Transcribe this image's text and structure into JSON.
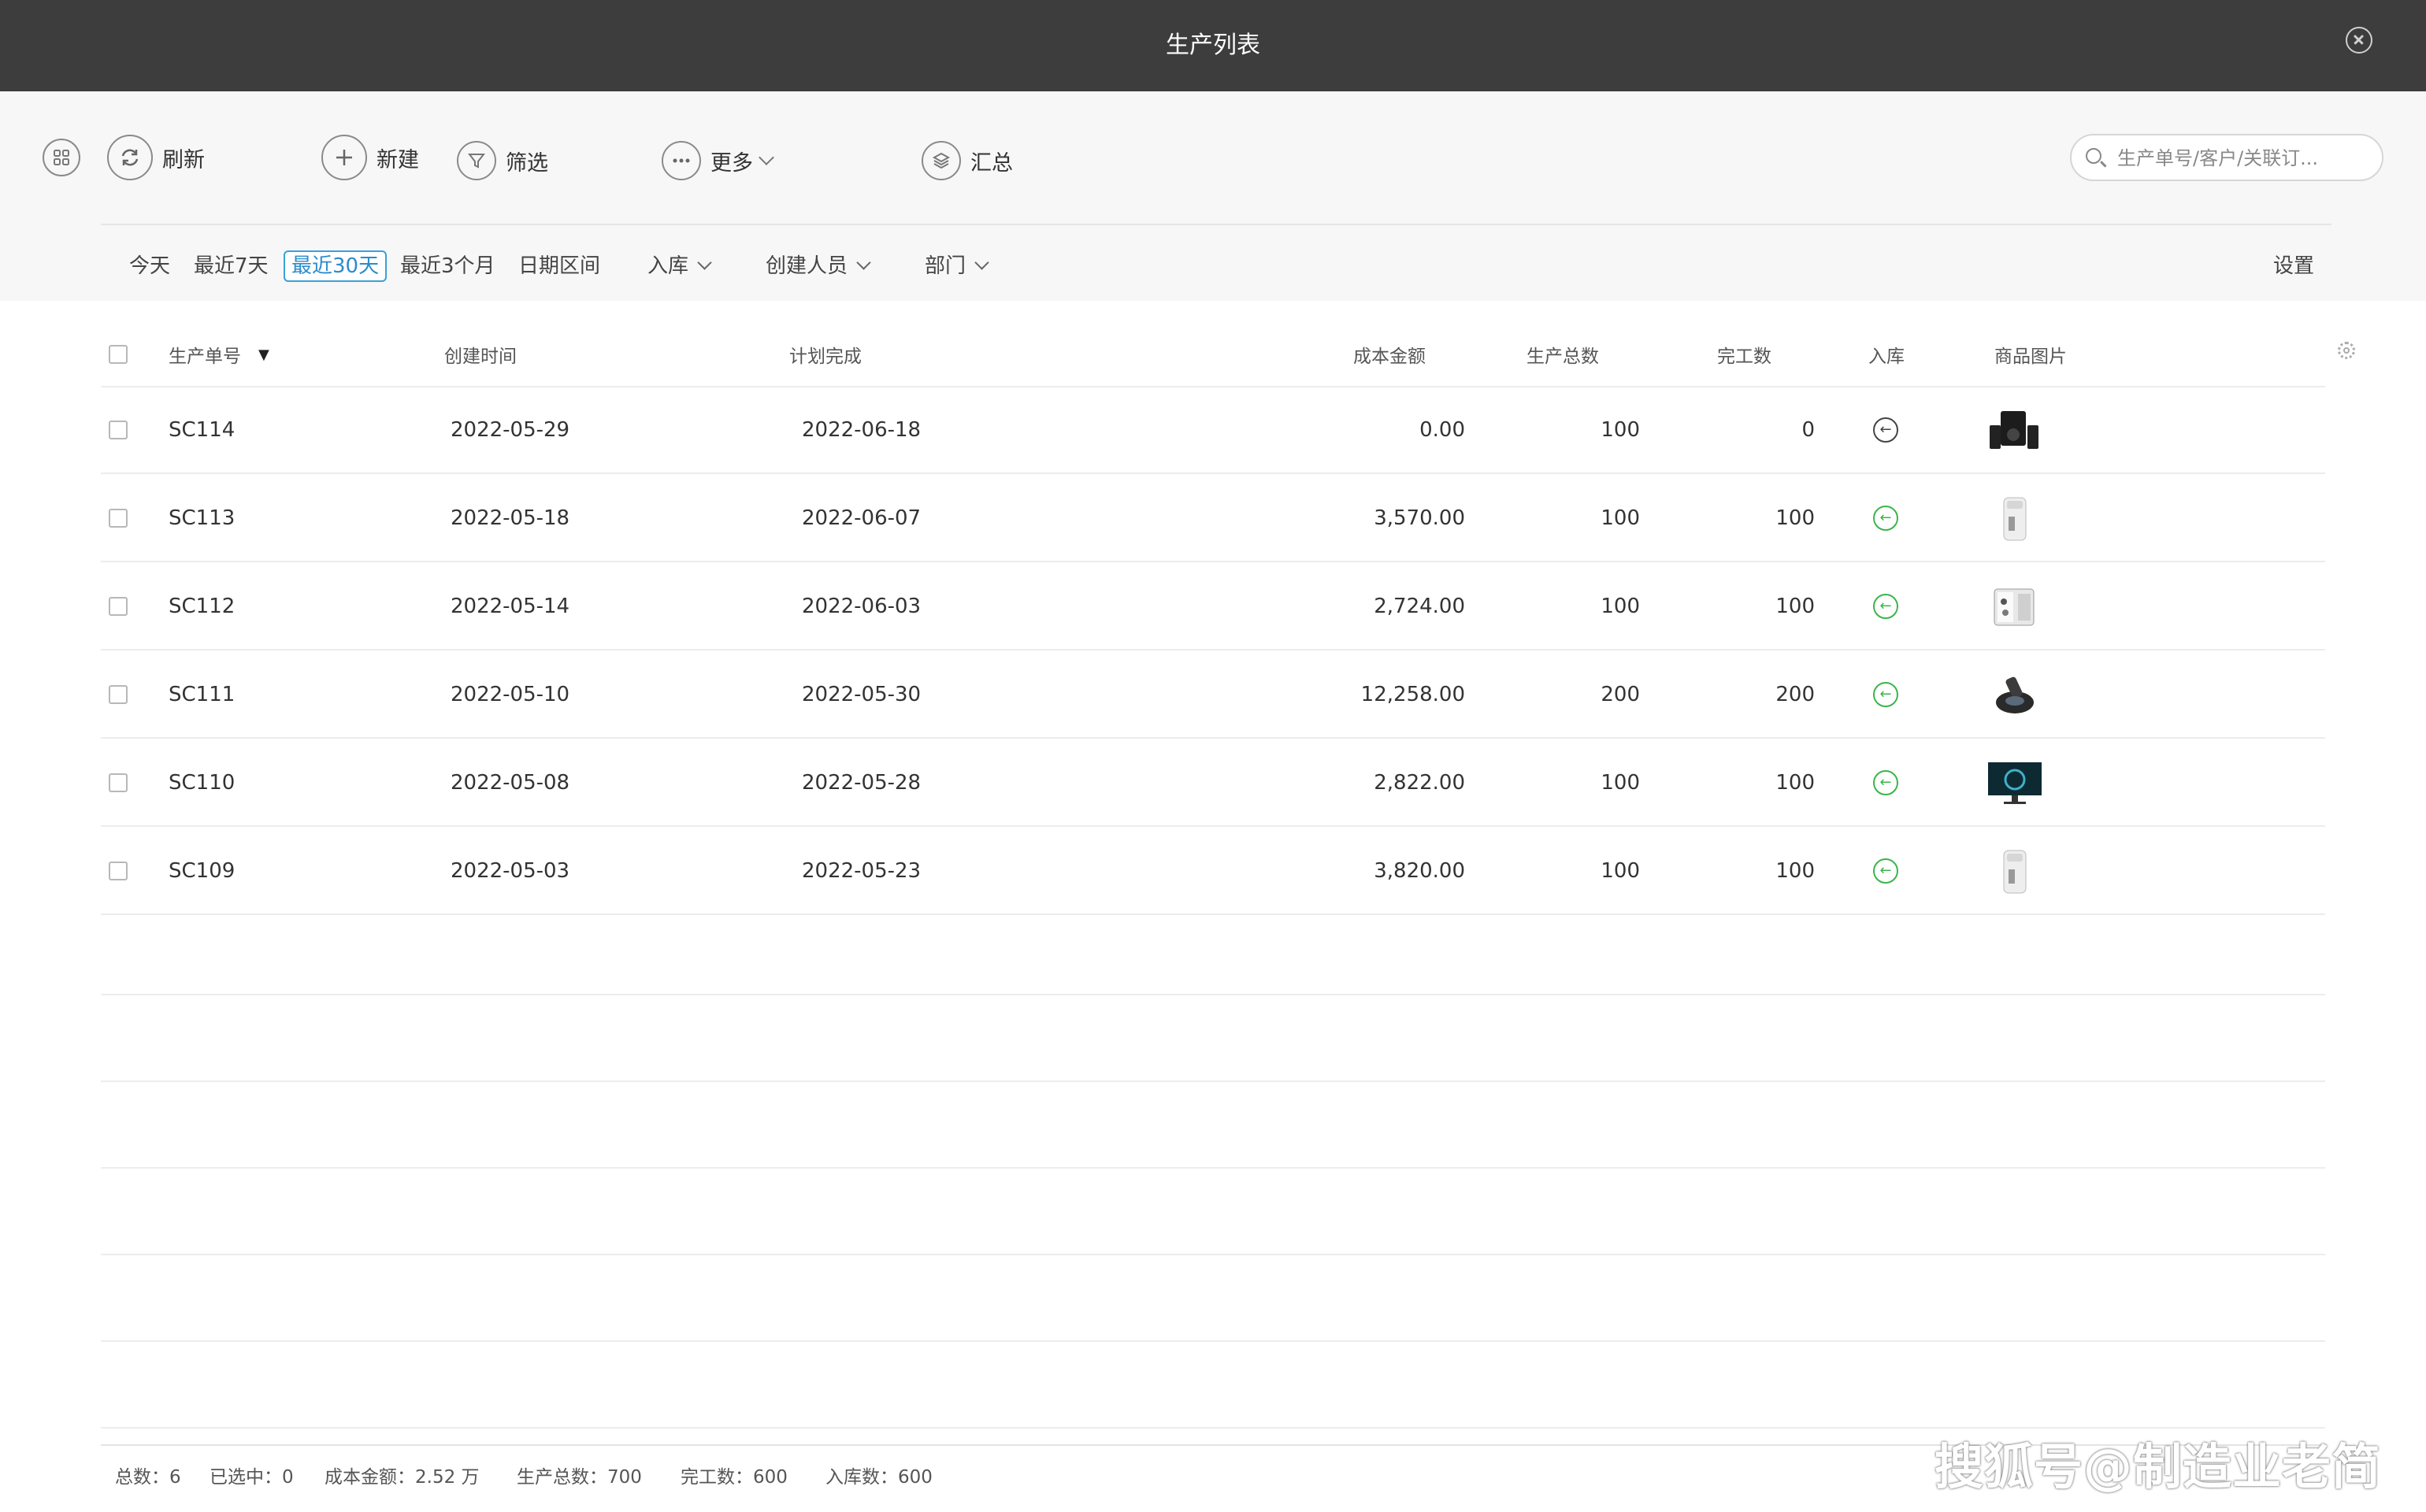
{
  "window": {
    "title": "生产列表"
  },
  "toolbar": {
    "refresh": "刷新",
    "new": "新建",
    "filter": "筛选",
    "more": "更多",
    "summary": "汇总",
    "search_placeholder": "生产单号/客户/关联订..."
  },
  "filters": {
    "today": "今天",
    "last7": "最近7天",
    "last30": "最近30天",
    "last3m": "最近3个月",
    "range": "日期区间",
    "stock": "入库",
    "creator": "创建人员",
    "dept": "部门",
    "settings": "设置",
    "active": "最近30天"
  },
  "columns": {
    "order_no": "生产单号",
    "created": "创建时间",
    "planned": "计划完成",
    "cost": "成本金额",
    "total": "生产总数",
    "done": "完工数",
    "stock": "入库",
    "image": "商品图片"
  },
  "rows": [
    {
      "order_no": "SC114",
      "created": "2022-05-29",
      "planned": "2022-06-18",
      "cost": "0.00",
      "total": "100",
      "done": "0",
      "stock_done": false,
      "image": "speakers"
    },
    {
      "order_no": "SC113",
      "created": "2022-05-18",
      "planned": "2022-06-07",
      "cost": "3,570.00",
      "total": "100",
      "done": "100",
      "stock_done": true,
      "image": "water-purifier"
    },
    {
      "order_no": "SC112",
      "created": "2022-05-14",
      "planned": "2022-06-03",
      "cost": "2,724.00",
      "total": "100",
      "done": "100",
      "stock_done": true,
      "image": "mini-fridge"
    },
    {
      "order_no": "SC111",
      "created": "2022-05-10",
      "planned": "2022-05-30",
      "cost": "12,258.00",
      "total": "200",
      "done": "200",
      "stock_done": true,
      "image": "vacuum"
    },
    {
      "order_no": "SC110",
      "created": "2022-05-08",
      "planned": "2022-05-28",
      "cost": "2,822.00",
      "total": "100",
      "done": "100",
      "stock_done": true,
      "image": "monitor"
    },
    {
      "order_no": "SC109",
      "created": "2022-05-03",
      "planned": "2022-05-23",
      "cost": "3,820.00",
      "total": "100",
      "done": "100",
      "stock_done": true,
      "image": "water-purifier"
    }
  ],
  "footer": {
    "total": "总数：6",
    "selected": "已选中：0",
    "cost": "成本金额：2.52 万",
    "produced": "生产总数：700",
    "done": "完工数：600",
    "stocked": "入库数：600"
  },
  "watermark": "搜狐号@制造业老简",
  "colors": {
    "titlebar": "#3d3d3d",
    "accent": "#3aa0d8",
    "stock_green": "#3bb54a"
  }
}
